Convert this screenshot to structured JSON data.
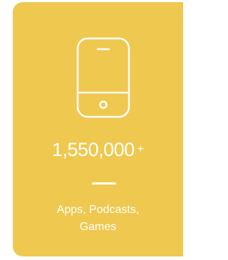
{
  "card": {
    "icon": "smartphone-icon",
    "stat_value": "1,550,000",
    "stat_suffix": "+",
    "caption_line1": "Apps, Podcasts,",
    "caption_line2": "Games",
    "background_color": "#efc84f",
    "text_color": "#ffffff"
  }
}
